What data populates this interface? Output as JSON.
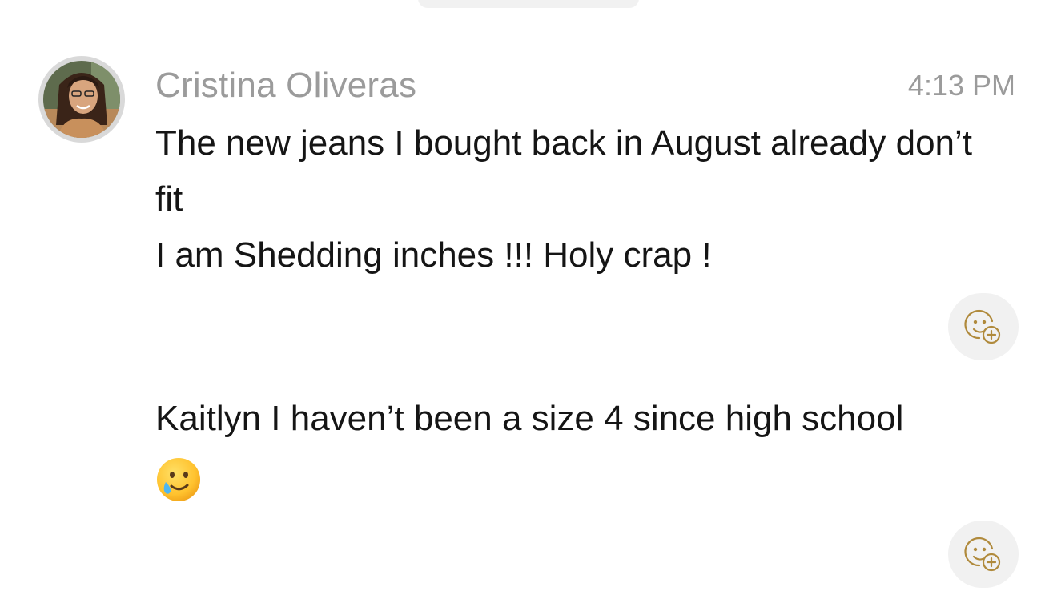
{
  "message": {
    "sender": "Cristina Oliveras",
    "time": "4:13 PM",
    "avatar_icon": "profile-photo",
    "bubbles": [
      {
        "lines": [
          "The new jeans I bought back in August already don’t fit",
          "I am Shedding inches !!! Holy crap !"
        ]
      },
      {
        "lines": [
          "Kaitlyn I haven’t been a size 4 since high school"
        ],
        "emoji": "smiling-face-with-tear"
      }
    ]
  },
  "colors": {
    "meta_text": "#9b9b9b",
    "body_text": "#151515",
    "reaction_bg": "#f1f1f1",
    "reaction_icon": "#b08a3c",
    "avatar_ring": "#d9d9d9"
  },
  "icons": {
    "reaction": "add-reaction-icon"
  }
}
